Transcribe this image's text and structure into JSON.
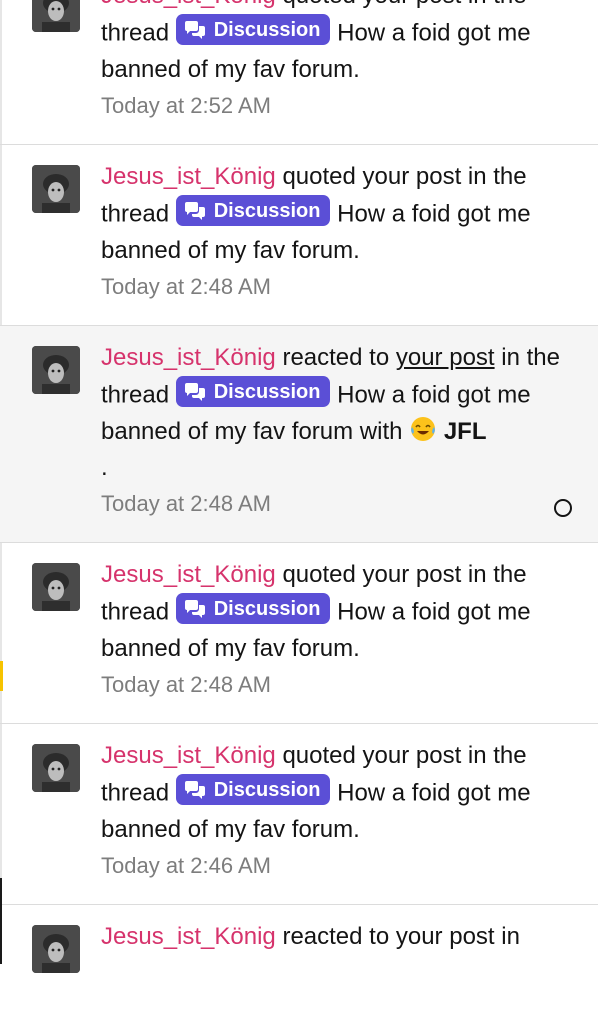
{
  "notifications": [
    {
      "user": "Jesus_ist_König",
      "action": "quoted your post in the",
      "thread_word": "thread",
      "tag": "Discussion",
      "title": "How a foid got me banned of my fav forum.",
      "time": "Today at 2:52 AM"
    },
    {
      "user": "Jesus_ist_König",
      "action": "quoted your post in the",
      "thread_word": "thread",
      "tag": "Discussion",
      "title": "How a foid got me banned of my fav forum.",
      "time": "Today at 2:48 AM"
    },
    {
      "user": "Jesus_ist_König",
      "action_pre": "reacted to",
      "post_link": "your post",
      "action_post": "in the thread",
      "tag": "Discussion",
      "title": "How a foid got me banned of my fav forum with",
      "reaction": "JFL",
      "trailing": ".",
      "time": "Today at 2:48 AM",
      "unread": true
    },
    {
      "user": "Jesus_ist_König",
      "action": "quoted your post in the",
      "thread_word": "thread",
      "tag": "Discussion",
      "title": "How a foid got me banned of my fav forum.",
      "time": "Today at 2:48 AM"
    },
    {
      "user": "Jesus_ist_König",
      "action": "quoted your post in the",
      "thread_word": "thread",
      "tag": "Discussion",
      "title": "How a foid got me banned of my fav forum.",
      "time": "Today at 2:46 AM"
    },
    {
      "user": "Jesus_ist_König",
      "action_pre": "reacted to",
      "post_link": "your post",
      "action_post": "in"
    }
  ],
  "icons": {
    "tag_icon": "chat-bubbles-icon",
    "reaction_icon": "tears-of-joy-emoji",
    "mark_read": "circle-icon"
  },
  "colors": {
    "username": "#d6336c",
    "tag_bg": "#5b4fd6",
    "unread_bg": "#f5f5f5",
    "time": "#7d7d7d"
  }
}
